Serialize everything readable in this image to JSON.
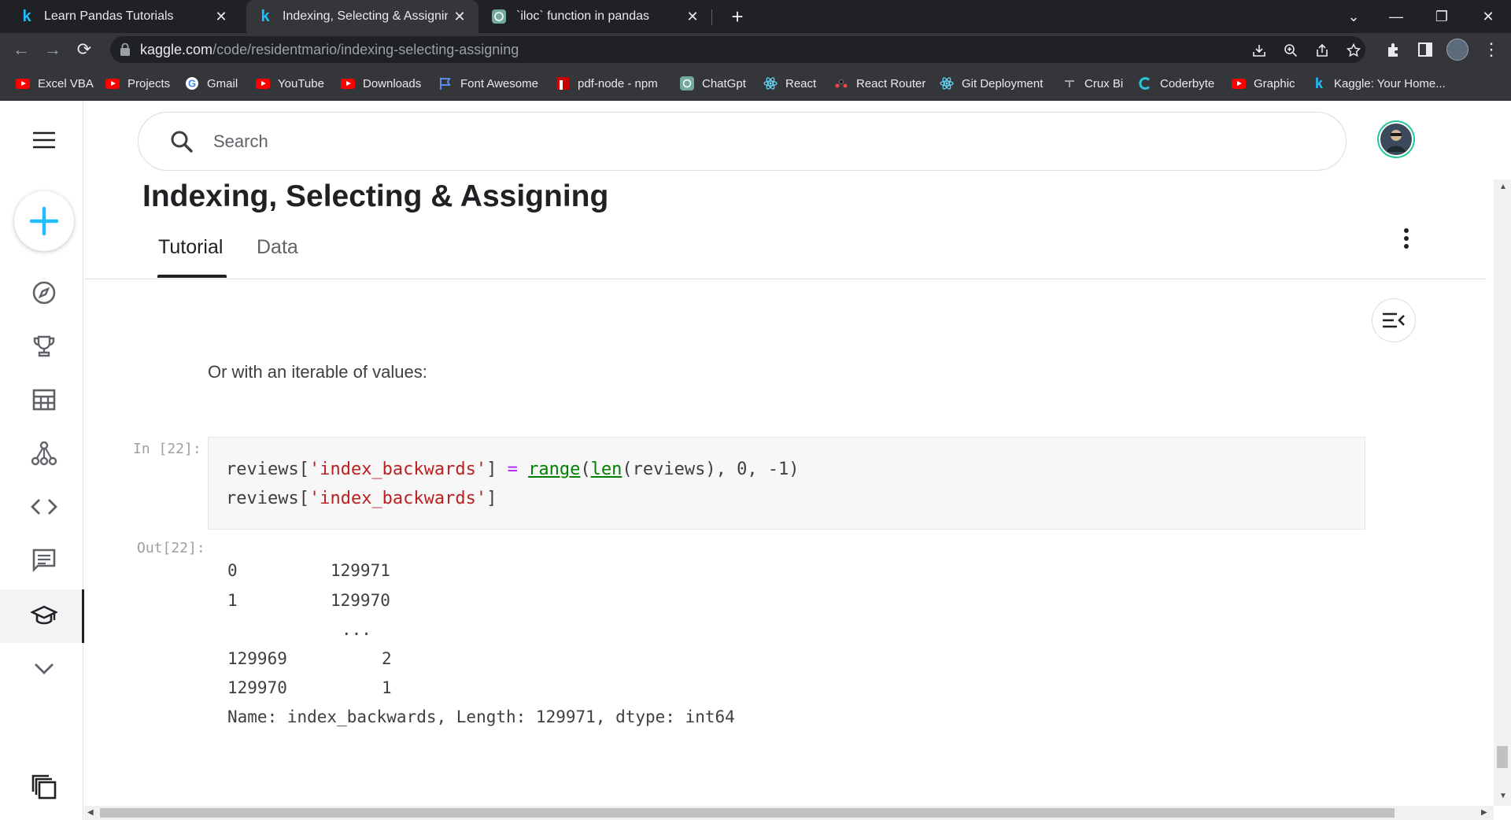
{
  "browser": {
    "tabs": [
      {
        "title": "Learn Pandas Tutorials",
        "favicon": "kaggle-k-icon"
      },
      {
        "title": "Indexing, Selecting & Assigning |",
        "favicon": "kaggle-k-icon",
        "active": true
      },
      {
        "title": "`iloc` function in pandas",
        "favicon": "chatgpt-icon"
      }
    ],
    "url_domain": "kaggle.com",
    "url_path": "/code/residentmario/indexing-selecting-assigning",
    "bookmarks": [
      {
        "label": "Excel VBA",
        "icon": "youtube-icon"
      },
      {
        "label": "Projects",
        "icon": "youtube-icon"
      },
      {
        "label": "Gmail",
        "icon": "google-icon"
      },
      {
        "label": "YouTube",
        "icon": "youtube-icon"
      },
      {
        "label": "Downloads",
        "icon": "youtube-icon"
      },
      {
        "label": "Font Awesome",
        "icon": "flag-icon"
      },
      {
        "label": "pdf-node - npm",
        "icon": "npm-icon"
      },
      {
        "label": "ChatGpt",
        "icon": "chatgpt-icon"
      },
      {
        "label": "React",
        "icon": "react-icon"
      },
      {
        "label": "React Router",
        "icon": "react-router-icon"
      },
      {
        "label": "Git Deployment",
        "icon": "react-icon"
      },
      {
        "label": "Crux Bi",
        "icon": "crux-icon"
      },
      {
        "label": "Coderbyte",
        "icon": "coderbyte-icon"
      },
      {
        "label": "Graphic",
        "icon": "youtube-icon"
      },
      {
        "label": "Kaggle: Your Home...",
        "icon": "kaggle-k-icon"
      }
    ]
  },
  "kaggle": {
    "search_placeholder": "Search",
    "page_title": "Indexing, Selecting & Assigning",
    "tabs": [
      "Tutorial",
      "Data"
    ],
    "prose": "Or with an iterable of values:",
    "cell": {
      "in_prompt": "In [22]:",
      "out_prompt": "Out[22]:",
      "line1": {
        "a": "reviews[",
        "b": "'index_backwards'",
        "c": "] ",
        "d": "=",
        "e": " ",
        "f": "range",
        "g": "(",
        "h": "len",
        "i": "(reviews), 0, -1)"
      },
      "line2": {
        "a": "reviews[",
        "b": "'index_backwards'",
        "c": "]"
      }
    },
    "output": {
      "rows": [
        {
          "index": "0",
          "value": "129971"
        },
        {
          "index": "1",
          "value": "129970"
        },
        {
          "index": "",
          "value": "..."
        },
        {
          "index": "129969",
          "value": "2"
        },
        {
          "index": "129970",
          "value": "1"
        }
      ],
      "footer": "Name: index_backwards, Length: 129971, dtype: int64"
    }
  },
  "colors": {
    "brand_blue": "#20beff",
    "string_red": "#ba2121",
    "builtin_green": "#008000"
  }
}
